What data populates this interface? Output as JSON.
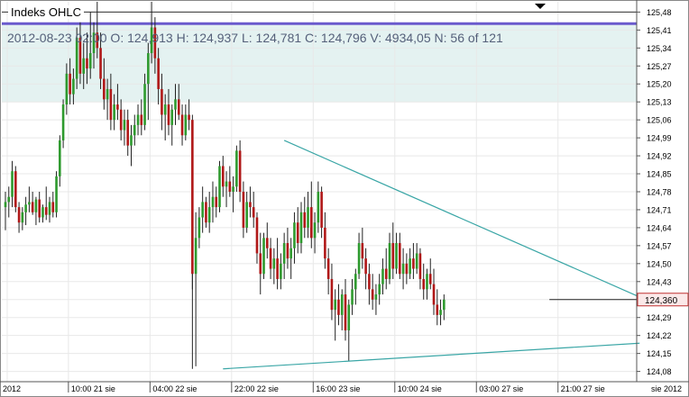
{
  "chart_data": {
    "type": "candlestick",
    "title": "Indeks OHLC",
    "info_line": "2012-08-23 02:00 O: 124,913 H: 124,937 L: 124,781 C: 124,796 V: 4934,05 N: 56 of 121",
    "current_price_label": "124,360",
    "current_price": 124.36,
    "ylim": [
      124.04,
      125.52
    ],
    "ytick_labels": [
      "125,48",
      "125,41",
      "125,34",
      "125,27",
      "125,20",
      "125,13",
      "125,06",
      "124,99",
      "124,92",
      "124,85",
      "124,78",
      "124,71",
      "124,64",
      "124,57",
      "124,50",
      "124,43",
      "124,36",
      "124,29",
      "124,22",
      "124,15",
      "124,08"
    ],
    "ytick_values": [
      125.48,
      125.41,
      125.34,
      125.27,
      125.2,
      125.13,
      125.06,
      124.99,
      124.92,
      124.85,
      124.78,
      124.71,
      124.64,
      124.57,
      124.5,
      124.43,
      124.36,
      124.29,
      124.22,
      124.15,
      124.08
    ],
    "xtick_labels": [
      "2012",
      "10:00 21 sie",
      "04:00 22 sie",
      "22:00 22 sie",
      "16:00 23 sie",
      "10:00 24 sie",
      "03:00 27 sie",
      "21:00 27 sie",
      "sie 2012"
    ],
    "xtick_bar_index": [
      0,
      18,
      42,
      66,
      90,
      114,
      138,
      162
    ],
    "bar_count": 161,
    "resistance_band": [
      125.13,
      125.43
    ],
    "horizontal_levels": [
      125.48,
      125.435
    ],
    "trendlines": [
      {
        "name": "upper",
        "from": [
          82,
          124.98
        ],
        "to": [
          186,
          124.37
        ]
      },
      {
        "name": "lower",
        "from": [
          64,
          124.09
        ],
        "to": [
          186,
          124.19
        ]
      }
    ],
    "candles": [
      {
        "o": 124.72,
        "h": 124.78,
        "l": 124.63,
        "c": 124.74
      },
      {
        "o": 124.74,
        "h": 124.8,
        "l": 124.68,
        "c": 124.76
      },
      {
        "o": 124.76,
        "h": 124.9,
        "l": 124.72,
        "c": 124.86
      },
      {
        "o": 124.86,
        "h": 124.88,
        "l": 124.7,
        "c": 124.72
      },
      {
        "o": 124.72,
        "h": 124.74,
        "l": 124.62,
        "c": 124.66
      },
      {
        "o": 124.66,
        "h": 124.72,
        "l": 124.63,
        "c": 124.7
      },
      {
        "o": 124.7,
        "h": 124.76,
        "l": 124.65,
        "c": 124.73
      },
      {
        "o": 124.73,
        "h": 124.8,
        "l": 124.7,
        "c": 124.74
      },
      {
        "o": 124.74,
        "h": 124.78,
        "l": 124.69,
        "c": 124.7
      },
      {
        "o": 124.7,
        "h": 124.76,
        "l": 124.65,
        "c": 124.75
      },
      {
        "o": 124.75,
        "h": 124.78,
        "l": 124.66,
        "c": 124.68
      },
      {
        "o": 124.68,
        "h": 124.73,
        "l": 124.66,
        "c": 124.72
      },
      {
        "o": 124.72,
        "h": 124.8,
        "l": 124.67,
        "c": 124.69
      },
      {
        "o": 124.69,
        "h": 124.76,
        "l": 124.66,
        "c": 124.74
      },
      {
        "o": 124.74,
        "h": 124.78,
        "l": 124.68,
        "c": 124.7
      },
      {
        "o": 124.7,
        "h": 124.86,
        "l": 124.68,
        "c": 124.84
      },
      {
        "o": 124.84,
        "h": 125.0,
        "l": 124.8,
        "c": 124.98
      },
      {
        "o": 124.98,
        "h": 125.14,
        "l": 124.95,
        "c": 125.12
      },
      {
        "o": 125.12,
        "h": 125.28,
        "l": 125.08,
        "c": 125.24
      },
      {
        "o": 125.24,
        "h": 125.3,
        "l": 125.12,
        "c": 125.16
      },
      {
        "o": 125.16,
        "h": 125.26,
        "l": 125.12,
        "c": 125.22
      },
      {
        "o": 125.22,
        "h": 125.42,
        "l": 125.18,
        "c": 125.38
      },
      {
        "o": 125.38,
        "h": 125.44,
        "l": 125.2,
        "c": 125.24
      },
      {
        "o": 125.24,
        "h": 125.36,
        "l": 125.18,
        "c": 125.3
      },
      {
        "o": 125.3,
        "h": 125.4,
        "l": 125.2,
        "c": 125.26
      },
      {
        "o": 125.26,
        "h": 125.48,
        "l": 125.22,
        "c": 125.32
      },
      {
        "o": 125.32,
        "h": 125.44,
        "l": 125.26,
        "c": 125.4
      },
      {
        "o": 125.4,
        "h": 125.52,
        "l": 125.3,
        "c": 125.34
      },
      {
        "o": 125.34,
        "h": 125.4,
        "l": 125.18,
        "c": 125.22
      },
      {
        "o": 125.22,
        "h": 125.3,
        "l": 125.1,
        "c": 125.14
      },
      {
        "o": 125.14,
        "h": 125.22,
        "l": 125.06,
        "c": 125.18
      },
      {
        "o": 125.18,
        "h": 125.24,
        "l": 125.02,
        "c": 125.06
      },
      {
        "o": 125.06,
        "h": 125.16,
        "l": 125.02,
        "c": 125.12
      },
      {
        "o": 125.12,
        "h": 125.2,
        "l": 125.06,
        "c": 125.1
      },
      {
        "o": 125.1,
        "h": 125.14,
        "l": 124.98,
        "c": 125.02
      },
      {
        "o": 125.02,
        "h": 125.1,
        "l": 124.96,
        "c": 125.06
      },
      {
        "o": 125.06,
        "h": 125.1,
        "l": 124.92,
        "c": 124.96
      },
      {
        "o": 124.96,
        "h": 125.04,
        "l": 124.88,
        "c": 125.0
      },
      {
        "o": 125.0,
        "h": 125.08,
        "l": 124.96,
        "c": 125.04
      },
      {
        "o": 125.04,
        "h": 125.12,
        "l": 125.0,
        "c": 125.08
      },
      {
        "o": 125.08,
        "h": 125.14,
        "l": 125.0,
        "c": 125.04
      },
      {
        "o": 125.04,
        "h": 125.24,
        "l": 125.02,
        "c": 125.2
      },
      {
        "o": 125.2,
        "h": 125.36,
        "l": 125.06,
        "c": 125.32
      },
      {
        "o": 125.32,
        "h": 125.52,
        "l": 125.28,
        "c": 125.42
      },
      {
        "o": 125.42,
        "h": 125.46,
        "l": 125.24,
        "c": 125.3
      },
      {
        "o": 125.3,
        "h": 125.34,
        "l": 125.12,
        "c": 125.18
      },
      {
        "o": 125.18,
        "h": 125.24,
        "l": 125.02,
        "c": 125.08
      },
      {
        "o": 125.08,
        "h": 125.16,
        "l": 124.98,
        "c": 125.12
      },
      {
        "o": 125.12,
        "h": 125.18,
        "l": 125.0,
        "c": 125.04
      },
      {
        "o": 125.04,
        "h": 125.12,
        "l": 124.96,
        "c": 125.1
      },
      {
        "o": 125.1,
        "h": 125.2,
        "l": 125.04,
        "c": 125.14
      },
      {
        "o": 125.14,
        "h": 125.2,
        "l": 125.06,
        "c": 125.08
      },
      {
        "o": 125.08,
        "h": 125.12,
        "l": 124.96,
        "c": 125.0
      },
      {
        "o": 125.0,
        "h": 125.12,
        "l": 124.98,
        "c": 125.08
      },
      {
        "o": 125.08,
        "h": 125.14,
        "l": 125.02,
        "c": 125.06
      },
      {
        "o": 125.06,
        "h": 125.08,
        "l": 124.4,
        "c": 124.46
      },
      {
        "o": 124.46,
        "h": 124.7,
        "l": 124.1,
        "c": 124.6
      },
      {
        "o": 124.6,
        "h": 124.72,
        "l": 124.56,
        "c": 124.68
      },
      {
        "o": 124.68,
        "h": 124.8,
        "l": 124.62,
        "c": 124.74
      },
      {
        "o": 124.74,
        "h": 124.76,
        "l": 124.64,
        "c": 124.66
      },
      {
        "o": 124.66,
        "h": 124.78,
        "l": 124.62,
        "c": 124.72
      },
      {
        "o": 124.72,
        "h": 124.82,
        "l": 124.66,
        "c": 124.76
      },
      {
        "o": 124.76,
        "h": 124.8,
        "l": 124.68,
        "c": 124.72
      },
      {
        "o": 124.72,
        "h": 124.9,
        "l": 124.7,
        "c": 124.88
      },
      {
        "o": 124.88,
        "h": 124.92,
        "l": 124.76,
        "c": 124.8
      },
      {
        "o": 124.8,
        "h": 124.86,
        "l": 124.72,
        "c": 124.82
      },
      {
        "o": 124.82,
        "h": 124.88,
        "l": 124.76,
        "c": 124.78
      },
      {
        "o": 124.78,
        "h": 124.84,
        "l": 124.7,
        "c": 124.8
      },
      {
        "o": 124.8,
        "h": 124.96,
        "l": 124.78,
        "c": 124.94
      },
      {
        "o": 124.94,
        "h": 124.98,
        "l": 124.74,
        "c": 124.78
      },
      {
        "o": 124.78,
        "h": 124.82,
        "l": 124.6,
        "c": 124.64
      },
      {
        "o": 124.64,
        "h": 124.78,
        "l": 124.62,
        "c": 124.74
      },
      {
        "o": 124.74,
        "h": 124.8,
        "l": 124.68,
        "c": 124.72
      },
      {
        "o": 124.72,
        "h": 124.78,
        "l": 124.64,
        "c": 124.68
      },
      {
        "o": 124.68,
        "h": 124.7,
        "l": 124.5,
        "c": 124.54
      },
      {
        "o": 124.54,
        "h": 124.62,
        "l": 124.38,
        "c": 124.46
      },
      {
        "o": 124.46,
        "h": 124.62,
        "l": 124.44,
        "c": 124.6
      },
      {
        "o": 124.6,
        "h": 124.66,
        "l": 124.52,
        "c": 124.56
      },
      {
        "o": 124.56,
        "h": 124.6,
        "l": 124.44,
        "c": 124.48
      },
      {
        "o": 124.48,
        "h": 124.56,
        "l": 124.42,
        "c": 124.52
      },
      {
        "o": 124.52,
        "h": 124.6,
        "l": 124.4,
        "c": 124.44
      },
      {
        "o": 124.44,
        "h": 124.54,
        "l": 124.4,
        "c": 124.5
      },
      {
        "o": 124.5,
        "h": 124.62,
        "l": 124.44,
        "c": 124.58
      },
      {
        "o": 124.58,
        "h": 124.64,
        "l": 124.48,
        "c": 124.52
      },
      {
        "o": 124.52,
        "h": 124.6,
        "l": 124.44,
        "c": 124.56
      },
      {
        "o": 124.56,
        "h": 124.7,
        "l": 124.5,
        "c": 124.66
      },
      {
        "o": 124.66,
        "h": 124.72,
        "l": 124.54,
        "c": 124.58
      },
      {
        "o": 124.58,
        "h": 124.74,
        "l": 124.54,
        "c": 124.7
      },
      {
        "o": 124.7,
        "h": 124.76,
        "l": 124.6,
        "c": 124.64
      },
      {
        "o": 124.64,
        "h": 124.78,
        "l": 124.6,
        "c": 124.72
      },
      {
        "o": 124.72,
        "h": 124.82,
        "l": 124.56,
        "c": 124.6
      },
      {
        "o": 124.6,
        "h": 124.7,
        "l": 124.54,
        "c": 124.66
      },
      {
        "o": 124.66,
        "h": 124.82,
        "l": 124.62,
        "c": 124.78
      },
      {
        "o": 124.78,
        "h": 124.8,
        "l": 124.6,
        "c": 124.64
      },
      {
        "o": 124.64,
        "h": 124.7,
        "l": 124.48,
        "c": 124.52
      },
      {
        "o": 124.52,
        "h": 124.56,
        "l": 124.38,
        "c": 124.44
      },
      {
        "o": 124.44,
        "h": 124.5,
        "l": 124.28,
        "c": 124.32
      },
      {
        "o": 124.32,
        "h": 124.4,
        "l": 124.2,
        "c": 124.36
      },
      {
        "o": 124.36,
        "h": 124.42,
        "l": 124.26,
        "c": 124.3
      },
      {
        "o": 124.3,
        "h": 124.4,
        "l": 124.24,
        "c": 124.38
      },
      {
        "o": 124.38,
        "h": 124.44,
        "l": 124.2,
        "c": 124.24
      },
      {
        "o": 124.24,
        "h": 124.36,
        "l": 124.12,
        "c": 124.34
      },
      {
        "o": 124.34,
        "h": 124.44,
        "l": 124.3,
        "c": 124.4
      },
      {
        "o": 124.4,
        "h": 124.48,
        "l": 124.34,
        "c": 124.46
      },
      {
        "o": 124.46,
        "h": 124.62,
        "l": 124.44,
        "c": 124.58
      },
      {
        "o": 124.58,
        "h": 124.64,
        "l": 124.48,
        "c": 124.52
      },
      {
        "o": 124.52,
        "h": 124.56,
        "l": 124.4,
        "c": 124.46
      },
      {
        "o": 124.46,
        "h": 124.5,
        "l": 124.34,
        "c": 124.4
      },
      {
        "o": 124.4,
        "h": 124.46,
        "l": 124.32,
        "c": 124.36
      },
      {
        "o": 124.36,
        "h": 124.42,
        "l": 124.3,
        "c": 124.38
      },
      {
        "o": 124.38,
        "h": 124.46,
        "l": 124.34,
        "c": 124.42
      },
      {
        "o": 124.42,
        "h": 124.52,
        "l": 124.38,
        "c": 124.48
      },
      {
        "o": 124.48,
        "h": 124.56,
        "l": 124.4,
        "c": 124.44
      },
      {
        "o": 124.44,
        "h": 124.62,
        "l": 124.42,
        "c": 124.58
      },
      {
        "o": 124.58,
        "h": 124.66,
        "l": 124.44,
        "c": 124.48
      },
      {
        "o": 124.48,
        "h": 124.62,
        "l": 124.46,
        "c": 124.58
      },
      {
        "o": 124.58,
        "h": 124.62,
        "l": 124.44,
        "c": 124.46
      },
      {
        "o": 124.46,
        "h": 124.56,
        "l": 124.4,
        "c": 124.5
      },
      {
        "o": 124.5,
        "h": 124.54,
        "l": 124.42,
        "c": 124.46
      },
      {
        "o": 124.46,
        "h": 124.56,
        "l": 124.44,
        "c": 124.52
      },
      {
        "o": 124.52,
        "h": 124.58,
        "l": 124.44,
        "c": 124.48
      },
      {
        "o": 124.48,
        "h": 124.58,
        "l": 124.46,
        "c": 124.54
      },
      {
        "o": 124.54,
        "h": 124.56,
        "l": 124.4,
        "c": 124.44
      },
      {
        "o": 124.44,
        "h": 124.5,
        "l": 124.36,
        "c": 124.4
      },
      {
        "o": 124.4,
        "h": 124.48,
        "l": 124.36,
        "c": 124.46
      },
      {
        "o": 124.46,
        "h": 124.52,
        "l": 124.4,
        "c": 124.42
      },
      {
        "o": 124.42,
        "h": 124.48,
        "l": 124.3,
        "c": 124.34
      },
      {
        "o": 124.34,
        "h": 124.4,
        "l": 124.26,
        "c": 124.3
      },
      {
        "o": 124.3,
        "h": 124.36,
        "l": 124.26,
        "c": 124.32
      },
      {
        "o": 124.32,
        "h": 124.38,
        "l": 124.28,
        "c": 124.36
      }
    ]
  }
}
